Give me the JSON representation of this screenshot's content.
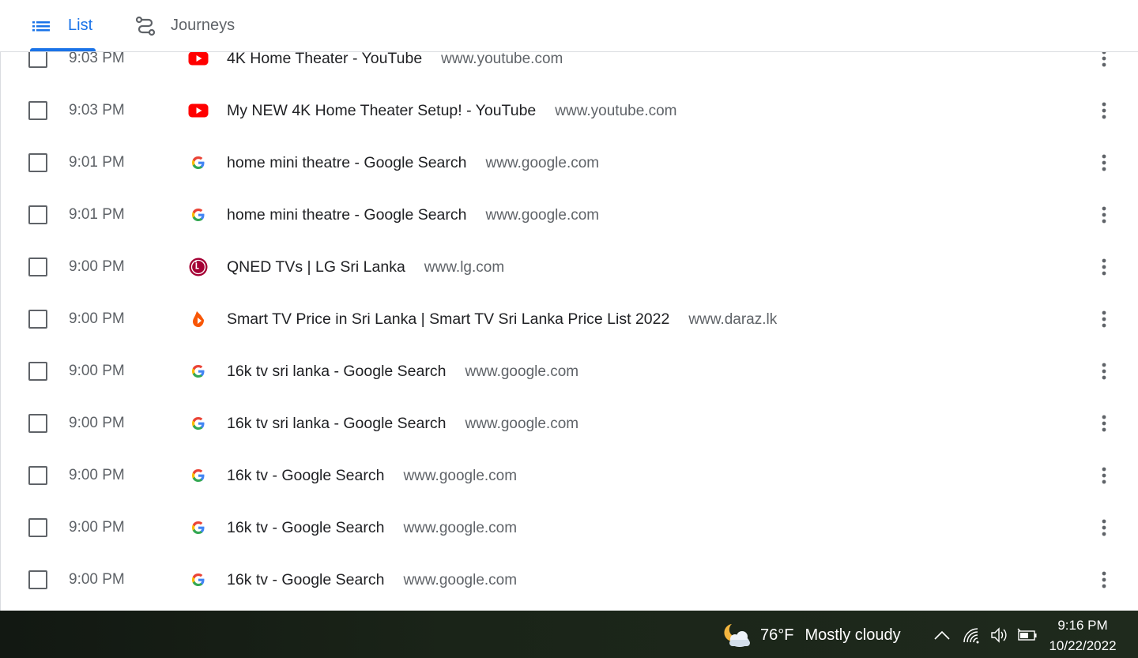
{
  "tabs": {
    "list": {
      "label": "List",
      "icon": "list-icon",
      "selected": true
    },
    "journeys": {
      "label": "Journeys",
      "icon": "journeys-icon",
      "selected": false
    }
  },
  "history": {
    "rows": [
      {
        "time": "9:03 PM",
        "favicon": "youtube-icon",
        "title": "4K Home Theater - YouTube",
        "domain": "www.youtube.com"
      },
      {
        "time": "9:03 PM",
        "favicon": "youtube-icon",
        "title": "My NEW 4K Home Theater Setup! - YouTube",
        "domain": "www.youtube.com"
      },
      {
        "time": "9:01 PM",
        "favicon": "google-icon",
        "title": "home mini theatre - Google Search",
        "domain": "www.google.com"
      },
      {
        "time": "9:01 PM",
        "favicon": "google-icon",
        "title": "home mini theatre - Google Search",
        "domain": "www.google.com"
      },
      {
        "time": "9:00 PM",
        "favicon": "lg-icon",
        "title": "QNED TVs | LG Sri Lanka",
        "domain": "www.lg.com"
      },
      {
        "time": "9:00 PM",
        "favicon": "daraz-icon",
        "title": "Smart TV Price in Sri Lanka | Smart TV Sri Lanka Price List 2022",
        "domain": "www.daraz.lk"
      },
      {
        "time": "9:00 PM",
        "favicon": "google-icon",
        "title": "16k tv sri lanka - Google Search",
        "domain": "www.google.com"
      },
      {
        "time": "9:00 PM",
        "favicon": "google-icon",
        "title": "16k tv sri lanka - Google Search",
        "domain": "www.google.com"
      },
      {
        "time": "9:00 PM",
        "favicon": "google-icon",
        "title": "16k tv - Google Search",
        "domain": "www.google.com"
      },
      {
        "time": "9:00 PM",
        "favicon": "google-icon",
        "title": "16k tv - Google Search",
        "domain": "www.google.com"
      },
      {
        "time": "9:00 PM",
        "favicon": "google-icon",
        "title": "16k tv - Google Search",
        "domain": "www.google.com"
      }
    ]
  },
  "taskbar": {
    "weather": {
      "icon": "partly-cloudy-night-icon",
      "temperature": "76°F",
      "condition": "Mostly cloudy"
    },
    "tray": [
      "chevron-up-icon",
      "wifi-icon",
      "volume-icon",
      "battery-icon"
    ],
    "clock": {
      "time": "9:16 PM",
      "date": "10/22/2022"
    }
  },
  "colors": {
    "accent": "#1a73e8",
    "text_primary": "#202124",
    "text_secondary": "#5f6368",
    "youtube_red": "#ff0000",
    "lg_red": "#a50034",
    "daraz_orange": "#f85606"
  }
}
